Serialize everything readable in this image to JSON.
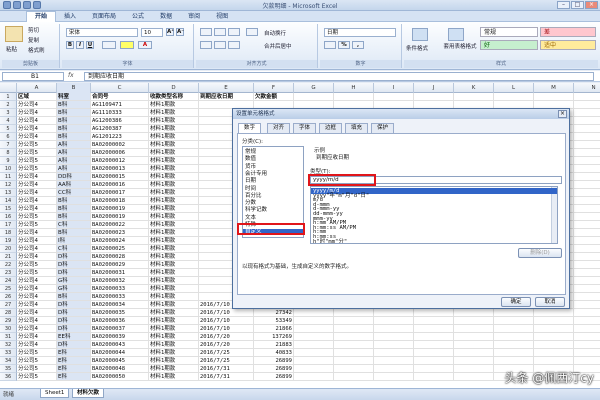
{
  "window": {
    "title": "欠款明细 - Microsoft Excel",
    "min": "–",
    "max": "□",
    "close": "×"
  },
  "ribbon": {
    "tabs": [
      "开始",
      "插入",
      "页面布局",
      "公式",
      "数据",
      "审阅",
      "视图"
    ],
    "clipboard": {
      "paste": "粘贴",
      "cut": "剪切",
      "copy": "复制",
      "format_painter": "格式刷",
      "label": "剪贴板"
    },
    "font": {
      "name": "宋体",
      "size": "10",
      "bold": "B",
      "italic": "I",
      "underline": "U",
      "grow": "A⁺",
      "shrink": "A⁻",
      "label": "字体",
      "color": "A"
    },
    "align": {
      "wrap": "自动换行",
      "merge": "合并后居中",
      "label": "对齐方式"
    },
    "number": {
      "format": "日期",
      "label": "数字",
      "percent": "%",
      "comma": ","
    },
    "styles": {
      "cond": "条件格式",
      "table": "套用表格格式",
      "normal": "常规",
      "bad": "差",
      "good": "好",
      "neutral": "适中",
      "label": "样式",
      "colors": {
        "normal": "#ffffff",
        "bad": "#ffc7ce",
        "good": "#c6efce",
        "neutral": "#ffeb9c"
      }
    }
  },
  "formula_bar": {
    "cell": "B1",
    "fx": "fx",
    "value": "到期应收日期"
  },
  "sheet": {
    "columns": [
      "A",
      "B",
      "C",
      "D",
      "E",
      "F",
      "G",
      "H",
      "I",
      "J",
      "K",
      "L",
      "M",
      "N"
    ],
    "headers": [
      "区域",
      "科室",
      "合同号",
      "收款类型名称",
      "到期应收日期",
      "欠款金额"
    ],
    "rows": [
      [
        "分公司4",
        "B科",
        "AG1109471",
        "材料1期款",
        "",
        ""
      ],
      [
        "分公司4",
        "B科",
        "AG1110333",
        "材料1期款",
        "",
        ""
      ],
      [
        "分公司4",
        "B科",
        "AG1200386",
        "材料1期款",
        "",
        ""
      ],
      [
        "分公司4",
        "B科",
        "AG1200387",
        "材料1期款",
        "",
        ""
      ],
      [
        "分公司4",
        "B科",
        "AG1201223",
        "材料1期款",
        "",
        ""
      ],
      [
        "分公司5",
        "A科",
        "BA02000002",
        "材料1期款",
        "",
        ""
      ],
      [
        "分公司5",
        "A科",
        "BA02000006",
        "材料1期款",
        "",
        ""
      ],
      [
        "分公司5",
        "A科",
        "BA02000012",
        "材料1期款",
        "",
        ""
      ],
      [
        "分公司5",
        "A科",
        "BA02000013",
        "材料1期款",
        "",
        ""
      ],
      [
        "分公司4",
        "DD科",
        "BA02000015",
        "材料1期款",
        "",
        ""
      ],
      [
        "分公司4",
        "AA科",
        "BA02000016",
        "材料1期款",
        "",
        ""
      ],
      [
        "分公司4",
        "CC科",
        "BA02000017",
        "材料1期款",
        "",
        ""
      ],
      [
        "分公司4",
        "B科",
        "BA02000018",
        "材料1期款",
        "",
        ""
      ],
      [
        "分公司4",
        "B科",
        "BA02000019",
        "材料1期款",
        "",
        ""
      ],
      [
        "分公司5",
        "B科",
        "BA02000019",
        "材料1期款",
        "",
        ""
      ],
      [
        "分公司5",
        "C科",
        "BA02000022",
        "材料1期款",
        "",
        ""
      ],
      [
        "分公司4",
        "B科",
        "BA02000023",
        "材料1期款",
        "",
        ""
      ],
      [
        "分公司4",
        "I科",
        "BA02000024",
        "材料1期款",
        "",
        ""
      ],
      [
        "分公司4",
        "C科",
        "BA02000025",
        "材料1期款",
        "",
        ""
      ],
      [
        "分公司4",
        "D科",
        "BA02000028",
        "材料1期款",
        "",
        ""
      ],
      [
        "分公司5",
        "D科",
        "BA02000029",
        "材料1期款",
        "",
        ""
      ],
      [
        "分公司5",
        "D科",
        "BA02000031",
        "材料1期款",
        "",
        ""
      ],
      [
        "分公司4",
        "G科",
        "BA02000032",
        "材料1期款",
        "",
        ""
      ],
      [
        "分公司4",
        "G科",
        "BA02000033",
        "材料1期款",
        "",
        ""
      ],
      [
        "分公司4",
        "B科",
        "BA02000033",
        "材料1期款",
        "",
        ""
      ],
      [
        "分公司4",
        "D科",
        "BA02000034",
        "材料1期款",
        "2016/7/10",
        "39949"
      ],
      [
        "分公司4",
        "D科",
        "BA02000035",
        "材料1期款",
        "2016/7/10",
        "27342"
      ],
      [
        "分公司4",
        "D科",
        "BA02000036",
        "材料1期款",
        "2016/7/10",
        "53349"
      ],
      [
        "分公司4",
        "D科",
        "BA02000037",
        "材料1期款",
        "2016/7/10",
        "21866"
      ],
      [
        "分公司4",
        "EE科",
        "BA02000039",
        "材料1期款",
        "2016/7/20",
        "137269"
      ],
      [
        "分公司4",
        "D科",
        "BA02000043",
        "材料1期款",
        "2016/7/20",
        "21883"
      ],
      [
        "分公司5",
        "E科",
        "BA02000044",
        "材料1期款",
        "2016/7/25",
        "40833"
      ],
      [
        "分公司5",
        "E科",
        "BA02000045",
        "材料1期款",
        "2016/7/25",
        "26899"
      ],
      [
        "分公司5",
        "E科",
        "BA02000048",
        "材料1期款",
        "2016/7/31",
        "26899"
      ],
      [
        "分公司5",
        "E科",
        "BA02000050",
        "材料1期款",
        "2016/7/31",
        "26899"
      ]
    ],
    "sheet_tabs": [
      "Sheet1",
      "材料欠款"
    ],
    "status": "就绪"
  },
  "dialog": {
    "title": "设置单元格格式",
    "close": "×",
    "tabs": [
      "数字",
      "对齐",
      "字体",
      "边框",
      "填充",
      "保护"
    ],
    "category_label": "分类(C):",
    "categories": [
      "常规",
      "数值",
      "货币",
      "会计专用",
      "日期",
      "时间",
      "百分比",
      "分数",
      "科学记数",
      "文本",
      "特殊",
      "自定义"
    ],
    "selected_category": "自定义",
    "sample_label": "示例",
    "sample_value": "到期应收日期",
    "type_label": "类型(T):",
    "type_value": "yyyy/m/d",
    "types": [
      "yyyy/m/d",
      "yyyy\"年\"m\"月\"d\"日\"",
      "m/d",
      "d-mmm",
      "d-mmm-yy",
      "dd-mmm-yy",
      "mmm-yy",
      "h:mm AM/PM",
      "h:mm:ss AM/PM",
      "h:mm",
      "h:mm:ss",
      "h\"时\"mm\"分\""
    ],
    "selected_type": "yyyy/m/d",
    "delete_label": "删除(D)",
    "description": "以现有格式为基础，生成自定义的数字格式。",
    "ok": "确定",
    "cancel": "取消"
  },
  "watermark": "头条 @佩西汀cy"
}
